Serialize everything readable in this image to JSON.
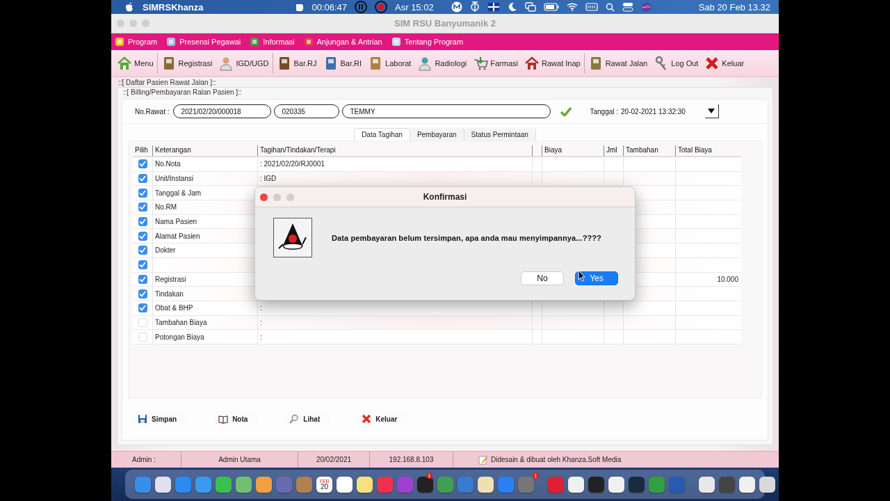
{
  "menu_bar": {
    "app_name": "SIMRSKhanza",
    "recording_time": "00:06:47",
    "prayer_time": "Asr 15:02",
    "clock": "Sab 20 Feb 13.32"
  },
  "window": {
    "title": "SIM RSU Banyumanik 2"
  },
  "main_menu": [
    "Program",
    "Presensi Pegawai",
    "Informasi",
    "Anjungan & Antrian",
    "Tentang Program"
  ],
  "toolbar": [
    "Menu",
    "Registrasi",
    "IGD/UGD",
    "Bar.RJ",
    "Bar.RI",
    "Laborat",
    "Radiologi",
    "Farmasi",
    "Rawat Inap",
    "Rawat Jalan",
    "Log Out",
    "Keluar"
  ],
  "outer_frame_title": "::[ Daftar Pasien Rawat Jalan ]::",
  "frame_title": "::[ Billing/Pembayaran Ralan Pasien ]::",
  "form": {
    "label": "No.Rawat :",
    "no_rawat": "2021/02/20/000018",
    "no_rm": "020335",
    "patient_name": "TEMMY",
    "date_label": "Tanggal :",
    "date_value": "20-02-2021 13:32:30"
  },
  "tabs": [
    {
      "label": "Data Tagihan",
      "selected": true
    },
    {
      "label": "Pembayaran",
      "selected": false
    },
    {
      "label": "Status Permintaan",
      "selected": false
    }
  ],
  "table": {
    "columns": [
      "Pilih",
      "Keterangan",
      "Tagihan/Tindakan/Terapi",
      "Biaya",
      "Jml",
      "Tambahan",
      "Total Biaya"
    ],
    "rows": [
      {
        "checked": true,
        "label": "No.Nota",
        "detail": ": 2021/02/20/RJ0001"
      },
      {
        "checked": true,
        "label": "Unit/Instansi",
        "detail": ": IGD"
      },
      {
        "checked": true,
        "label": "Tanggal & Jam"
      },
      {
        "checked": true,
        "label": "No.RM"
      },
      {
        "checked": true,
        "label": "Nama Pasien"
      },
      {
        "checked": true,
        "label": "Alamat Pasien"
      },
      {
        "checked": true,
        "label": "Dokter"
      },
      {
        "checked": true
      },
      {
        "checked": true,
        "label": "Registrasi",
        "total": "10.000"
      },
      {
        "checked": true,
        "label": "Tindakan"
      },
      {
        "checked": true,
        "label": "Obat & BHP",
        "detail": ":"
      },
      {
        "checked": false,
        "label": "Tambahan Biaya",
        "detail": ":"
      },
      {
        "checked": false,
        "label": "Potongan Biaya",
        "detail": ":"
      }
    ]
  },
  "actions": [
    "Simpan",
    "Nota",
    "Lihat",
    "Keluar"
  ],
  "status_bar": [
    "Admin :",
    "Admin Utama",
    "20/02/2021",
    "192.168.8.103",
    "Didesain & dibuat oleh Khanza.Soft Media"
  ],
  "dialog": {
    "title": "Konfirmasi",
    "message": "Data pembayaran belum tersimpan, apa anda mau menyimpannya...????",
    "buttons": [
      {
        "label": "No",
        "selected": false
      },
      {
        "label": "Yes",
        "selected": true
      }
    ]
  },
  "dock": {
    "calendar_month": "FEB",
    "calendar_day": "20",
    "tv_badge": "1",
    "settings_badge": "1"
  }
}
